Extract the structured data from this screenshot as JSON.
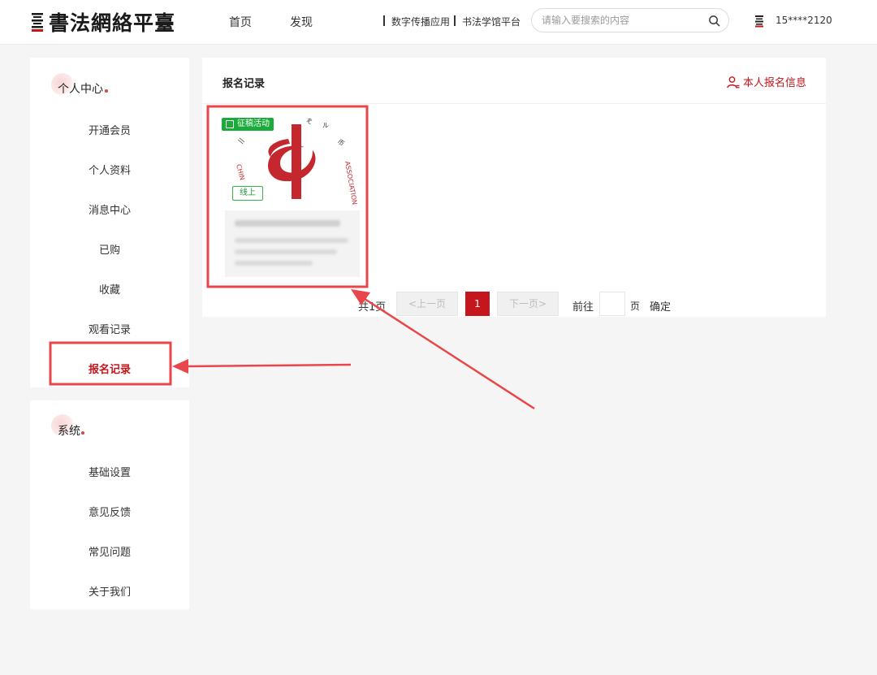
{
  "header": {
    "logo_text": "書法網絡平臺",
    "nav": {
      "home": "首页",
      "discover": "发现"
    },
    "links": {
      "digital_app": "数字传播应用",
      "academy": "书法学馆平台"
    },
    "search": {
      "placeholder": "请输入要搜索的内容"
    },
    "user_phone": "15****2120"
  },
  "sidebar": {
    "personal_title": "个人中心",
    "personal_items": [
      {
        "label": "开通会员"
      },
      {
        "label": "个人资料"
      },
      {
        "label": "消息中心"
      },
      {
        "label": "已购"
      },
      {
        "label": "收藏"
      },
      {
        "label": "观看记录"
      },
      {
        "label": "报名记录",
        "active": true
      }
    ],
    "system_title": "系统",
    "system_items": [
      {
        "label": "基础设置"
      },
      {
        "label": "意见反馈"
      },
      {
        "label": "常见问题"
      },
      {
        "label": "关于我们"
      }
    ]
  },
  "main": {
    "title": "报名记录",
    "self_info": "本人报名信息",
    "card": {
      "tag_type": "征稿活动",
      "tag_mode": "线上",
      "logo_text_left": "CHIN",
      "logo_text_right": "ASSOCIATION"
    },
    "pagination": {
      "total": "共1页",
      "prev": "<上一页",
      "current_page": "1",
      "next": "下一页>",
      "goto": "前往",
      "unit": "页",
      "confirm": "确定"
    }
  },
  "colors": {
    "brand_red": "#c4161c",
    "tag_green": "#1aab3a",
    "highlight": "#e8464a"
  }
}
